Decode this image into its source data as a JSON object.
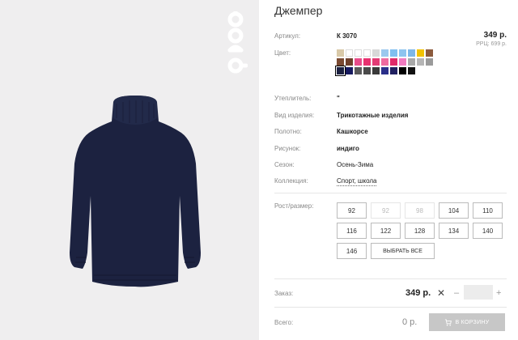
{
  "product": {
    "title": "Джемпер",
    "price": "349 р.",
    "rrp": "РРЦ: 699 р."
  },
  "labels": {
    "article": "Артикул:",
    "color": "Цвет:",
    "insulation": "Утеплитель:",
    "type": "Вид изделия:",
    "fabric": "Полотно:",
    "pattern": "Рисунок:",
    "season": "Сезон:",
    "collection": "Коллекция:",
    "size": "Рост/размер:",
    "order": "Заказ:",
    "total": "Всего:"
  },
  "values": {
    "article": "К 3070",
    "insulation": "\"",
    "type": "Трикотажные изделия",
    "fabric": "Кашкорсе",
    "pattern": "индиго",
    "season": "Осень-Зима",
    "collection": "Спорт, школа"
  },
  "swatches": [
    "#d9c9a8",
    "#ffffff",
    "#ffffff",
    "#ffffff",
    "#d8d8d8",
    "#9bc8ee",
    "#7fbff0",
    "#8ec4ef",
    "#7db7e8",
    "#f2c200",
    "#8b5a3c",
    "#7a4a32",
    "#6e3f2a",
    "#e84c8a",
    "#e8316f",
    "#e23a74",
    "#ee6aa0",
    "#e02a6a",
    "#f07abf",
    "#a8a8a8",
    "#b5b5b5",
    "#9a9a9a",
    "#1b2040",
    "#16195e",
    "#5a5a5a",
    "#4a4a4a",
    "#3a3a3a",
    "#2a2f8a",
    "#202060",
    "#000000",
    "#111111"
  ],
  "sizes": [
    {
      "label": "92",
      "disabled": false
    },
    {
      "label": "92",
      "disabled": true
    },
    {
      "label": "98",
      "disabled": true
    },
    {
      "label": "104",
      "disabled": false
    },
    {
      "label": "110",
      "disabled": false
    },
    {
      "label": "116",
      "disabled": false
    },
    {
      "label": "122",
      "disabled": false
    },
    {
      "label": "128",
      "disabled": false
    },
    {
      "label": "134",
      "disabled": false
    },
    {
      "label": "140",
      "disabled": false
    },
    {
      "label": "146",
      "disabled": false
    }
  ],
  "select_all_label": "ВЫБРАТЬ ВСЕ",
  "order": {
    "price": "349 р.",
    "minus": "–",
    "plus": "+",
    "quantity": ""
  },
  "total": {
    "price": "0 р.",
    "cart_label": "В КОРЗИНУ"
  },
  "icons": {
    "remove": "close-icon",
    "cart": "cart-icon",
    "brand": "brand-logo"
  }
}
